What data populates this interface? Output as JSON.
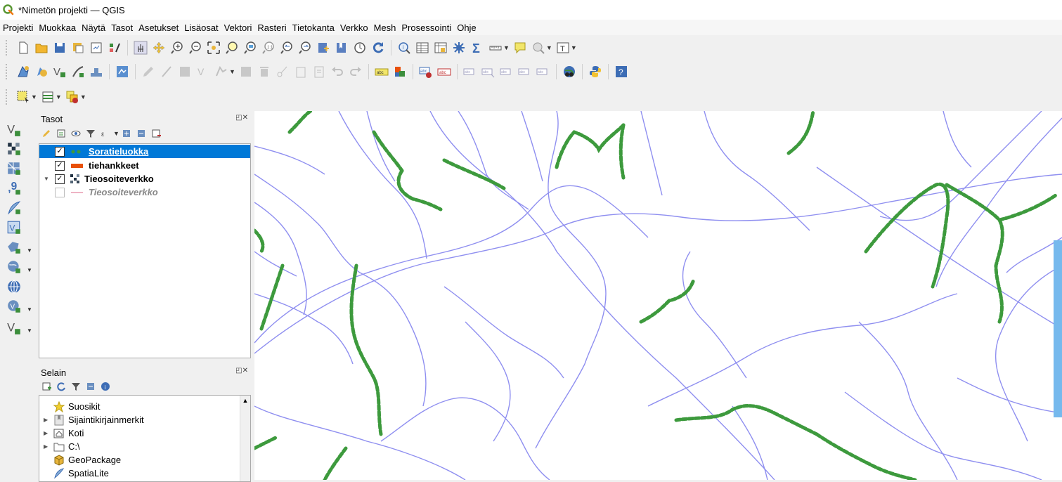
{
  "window": {
    "title": "*Nimetön projekti — QGIS"
  },
  "menubar": [
    "Projekti",
    "Muokkaa",
    "Näytä",
    "Tasot",
    "Asetukset",
    "Lisäosat",
    "Vektori",
    "Rasteri",
    "Tietokanta",
    "Verkko",
    "Mesh",
    "Prosessointi",
    "Ohje"
  ],
  "icons": {
    "toolbar1": [
      "new-project-icon",
      "open-project-icon",
      "save-project-icon",
      "save-as-icon",
      "print-layout-icon",
      "style-manager-icon",
      "pan-map-icon",
      "pan-to-selection-icon",
      "zoom-in-icon",
      "zoom-out-icon",
      "zoom-full-icon",
      "zoom-to-selection-icon",
      "zoom-to-layer-icon",
      "zoom-native-icon",
      "zoom-last-icon",
      "zoom-next-icon",
      "new-bookmark-icon",
      "show-bookmarks-icon",
      "temporal-controller-icon",
      "refresh-icon",
      "identify-features-icon",
      "attribute-table-icon",
      "field-calculator-icon",
      "processing-toolbox-icon",
      "statistical-summary-icon",
      "measure-line-icon",
      "map-tips-icon",
      "select-features-icon",
      "text-annotation-icon"
    ],
    "toolbar2": [
      "digitize-icon",
      "current-edits-icon",
      "add-feature-icon",
      "vertex-tool-icon",
      "save-edits-icon",
      "layer-diagram-icon",
      "edit-disabled-icon",
      "add-line-disabled-icon",
      "delete-disabled-icon",
      "copy-disabled-icon",
      "paste-disabled-icon",
      "undo-icon",
      "redo-icon",
      "label-icon",
      "label-color-icon",
      "pin-label-icon",
      "highlight-label-icon",
      "show-label-icon",
      "move-label-icon",
      "rotate-label-icon",
      "change-label-icon",
      "label-settings-icon",
      "globe-icon",
      "python-icon",
      "help-icon"
    ],
    "toolbar3": [
      "select-by-rect-icon",
      "select-by-value-icon",
      "deselect-icon"
    ]
  },
  "left_tools": [
    "add-vector-layer-icon",
    "add-raster-layer-icon",
    "add-mesh-layer-icon",
    "add-delimited-text-icon",
    "add-spatialite-icon",
    "add-virtual-layer-icon",
    "add-wms-layer-icon",
    "add-wfs-layer-icon",
    "add-xyz-layer-icon",
    "add-arcgis-layer-icon",
    "new-vector-layer-icon"
  ],
  "layers_panel": {
    "title": "Tasot",
    "layers": [
      {
        "name": "Soratieluokka",
        "checked": true,
        "selected": true,
        "symbol": "green-dots"
      },
      {
        "name": "tiehankkeet",
        "checked": true,
        "selected": false,
        "symbol": "orange-bar"
      },
      {
        "name": "Tieosoiteverkko",
        "checked": true,
        "selected": false,
        "symbol": "raster-grid",
        "expanded": true
      },
      {
        "name": "Tieosoiteverkko",
        "checked": false,
        "selected": false,
        "symbol": "pink-line",
        "italic": true
      }
    ]
  },
  "browser_panel": {
    "title": "Selain",
    "items": [
      {
        "label": "Suosikit",
        "icon": "star-icon",
        "expandable": false
      },
      {
        "label": "Sijaintikirjainmerkit",
        "icon": "bookmark-icon",
        "expandable": true
      },
      {
        "label": "Koti",
        "icon": "home-folder-icon",
        "expandable": true
      },
      {
        "label": "C:\\",
        "icon": "drive-icon",
        "expandable": true
      },
      {
        "label": "GeoPackage",
        "icon": "geopackage-icon",
        "expandable": false
      },
      {
        "label": "SpatiaLite",
        "icon": "spatialite-icon",
        "expandable": false
      }
    ]
  },
  "colors": {
    "road_line": "#8f8ff0",
    "gravel_road": "#3d9a3d",
    "selection": "#0078d7",
    "tiehankkeet": "#e8500a"
  }
}
